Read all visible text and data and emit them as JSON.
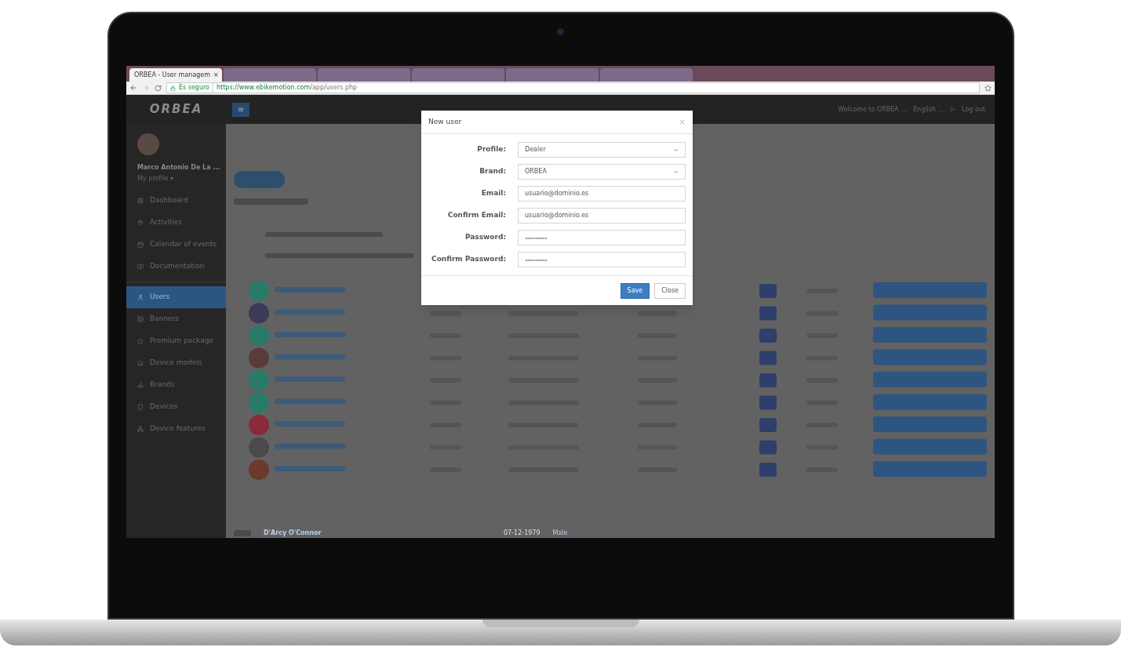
{
  "browser": {
    "tabs": [
      {
        "title": "ORBEA - User managem",
        "close": "×",
        "selected": true
      },
      {
        "selected": false
      },
      {
        "selected": false
      },
      {
        "selected": false
      },
      {
        "selected": false
      },
      {
        "selected": false
      }
    ],
    "security": "Es seguro",
    "url_host": "https://www.ebikemotion.com",
    "url_path": "/app/users.php"
  },
  "header": {
    "logo": "ORBEA",
    "menu_icon": "≡",
    "welcome": "Welcome to ORBEA ...",
    "language": "English ...",
    "logout": "Log out"
  },
  "sidebar": {
    "user_name": "Marco Antonio De La ...",
    "profile_link": "My profile ▾",
    "items": [
      {
        "label": "Dashboard",
        "selected": false
      },
      {
        "label": "Activities",
        "selected": false
      },
      {
        "label": "Calendar of events",
        "selected": false
      },
      {
        "label": "Documentation",
        "selected": false
      },
      {
        "label": "Users",
        "selected": true,
        "divider_before": true
      },
      {
        "label": "Banners",
        "selected": false
      },
      {
        "label": "Premium package",
        "selected": false
      },
      {
        "label": "Device models",
        "selected": false
      },
      {
        "label": "Brands",
        "selected": false
      },
      {
        "label": "Devices",
        "selected": false
      },
      {
        "label": "Device features",
        "selected": false
      }
    ]
  },
  "table": {
    "last_row": {
      "name": "D'Arcy O'Connor",
      "birthdate": "07-12-1979",
      "gender": "Male"
    }
  },
  "modal": {
    "title": "New user",
    "close": "×",
    "fields": [
      {
        "label": "Profile:",
        "kind": "select",
        "value": "Dealer"
      },
      {
        "label": "Brand:",
        "kind": "select",
        "value": "ORBEA"
      },
      {
        "label": "Email:",
        "kind": "text",
        "value": "usuario@dominio.es"
      },
      {
        "label": "Confirm Email:",
        "kind": "text",
        "value": "usuario@dominio.es"
      },
      {
        "label": "Password:",
        "kind": "password",
        "value": "•••••••••••"
      },
      {
        "label": "Confirm Password:",
        "kind": "password",
        "value": "•••••••••••"
      }
    ],
    "buttons": [
      {
        "label": "Save",
        "kind": "primary"
      },
      {
        "label": "Close",
        "kind": "default"
      }
    ]
  }
}
